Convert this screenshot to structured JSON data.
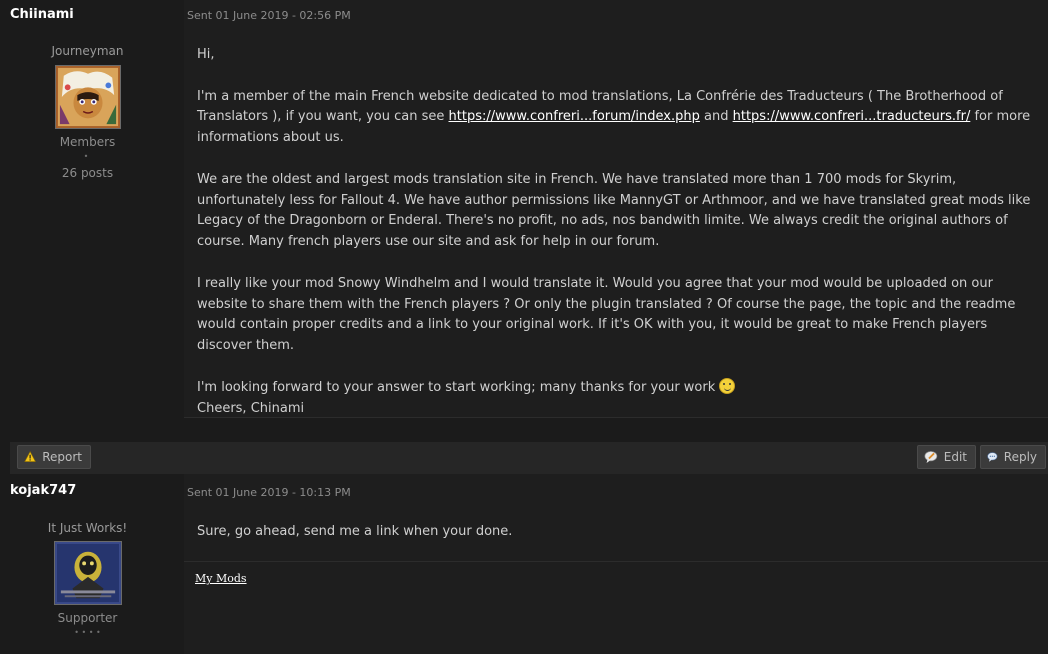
{
  "posts": [
    {
      "author": "Chiinami",
      "sent": "Sent 01 June 2019 - 02:56 PM",
      "rank_title": "Journeyman",
      "group": "Members",
      "pips": "•",
      "post_count": "26 posts",
      "body": {
        "greeting": "Hi,",
        "p1_a": "I'm a member of the main French website dedicated to mod translations, La Confrérie des Traducteurs ( The Brotherhood of Translators ), if you want, you can see ",
        "link1": "https://www.confreri...forum/index.php",
        "p1_b": " and ",
        "link2": "https://www.confreri...traducteurs.fr/",
        "p1_c": " for more informations about us.",
        "p2": "We are the oldest and largest mods translation site in French. We have translated more than 1 700 mods for Skyrim, unfortunately less for Fallout 4. We have author permissions like MannyGT or Arthmoor, and we have translated great mods like Legacy of the Dragonborn or Enderal. There's no profit, no ads, nos bandwith limite. We always credit the original authors of course. Many french players use our site and ask for help in our forum.",
        "p3": "I really like your mod Snowy Windhelm and I would translate it. Would you agree that your mod would be uploaded on our website to share them with the French players ? Or only the plugin translated ? Of course the page, the topic and the readme would contain proper credits and a link to your original work. If it's OK with you, it would be great to make French players discover them.",
        "p4": "I'm looking forward to your answer to start working; many thanks for your work ",
        "signoff": "Cheers, Chinami"
      }
    },
    {
      "author": "kojak747",
      "sent": "Sent 01 June 2019 - 10:13 PM",
      "rank_title": "It Just Works!",
      "group": "Supporter",
      "pips": "• • • •",
      "body": "Sure, go ahead, send me a link when your done.",
      "signature_link": "My Mods"
    }
  ],
  "actions": {
    "report": "Report",
    "edit": "Edit",
    "reply": "Reply"
  },
  "icons": {
    "report": "warning-icon",
    "edit": "pencil-bubble-icon",
    "reply": "speech-bubble-icon",
    "smiley": "wink-smiley-icon"
  },
  "colors": {
    "background": "#1b1b1b",
    "content_bg": "#1e1e1e",
    "text": "#d0d0d0",
    "link": "#ffffff",
    "meta": "#8c8c8c"
  }
}
